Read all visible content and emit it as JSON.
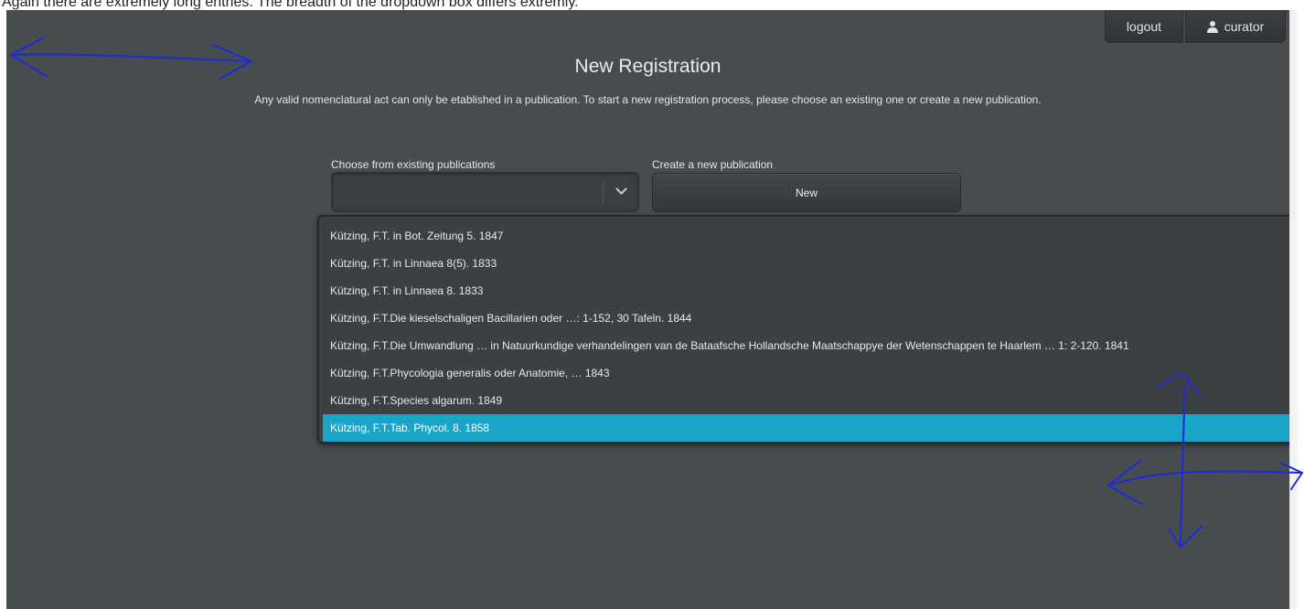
{
  "caption": "Again there are extremely long entries. The breadth of the dropdown box differs extremly.",
  "header": {
    "logout_label": "logout",
    "user_label": "curator",
    "user_icon": "user-icon"
  },
  "page": {
    "title": "New Registration",
    "intro": "Any valid nomenclatural act can only be etablished in a publication. To start a new registration process, please choose an existing one or create a new publication."
  },
  "existing": {
    "label": "Choose from existing publications",
    "value": "",
    "icon": "chevron-down-icon"
  },
  "create": {
    "label": "Create a new publication",
    "button_label": "New"
  },
  "dropdown": {
    "options": [
      "Kützing, F.T. in Bot. Zeitung 5. 1847",
      "Kützing, F.T. in Linnaea 8(5). 1833",
      "Kützing, F.T. in Linnaea 8. 1833",
      "Kützing, F.T.Die kieselschaligen Bacillarien oder …: 1-152, 30 Tafeln. 1844",
      "Kützing, F.T.Die Umwandlung … in Natuurkundige verhandelingen van de Bataafsche Hollandsche Maatschappye der Wetenschappen te Haarlem … 1: 2-120. 1841",
      "Kützing, F.T.Phycologia generalis oder Anatomie, … 1843",
      "Kützing, F.T.Species algarum. 1849",
      "Kützing, F.T.Tab. Phycol. 8. 1858"
    ],
    "selected_index": 7
  },
  "colors": {
    "background": "#474d4f",
    "highlight": "#1aa4c8",
    "annotation": "#1d2bd6"
  }
}
